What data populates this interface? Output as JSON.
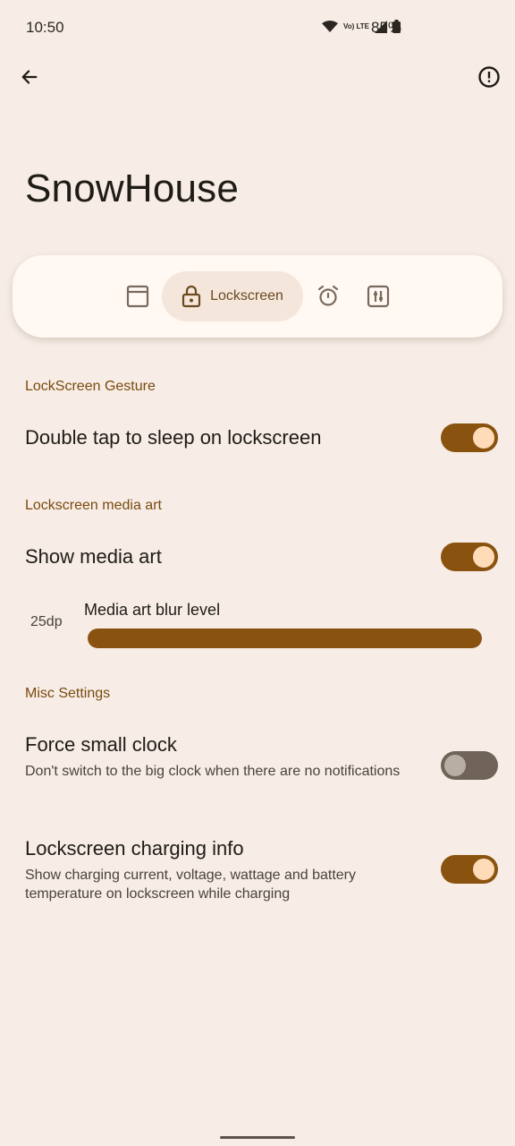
{
  "status_bar": {
    "time": "10:50",
    "signal_label": "Vo) LTE",
    "battery_percent": "85%"
  },
  "app_bar": {
    "back_icon": "arrow-left-icon",
    "info_icon": "info-circle-icon"
  },
  "page": {
    "title": "SnowHouse"
  },
  "tabs": {
    "items": [
      {
        "icon": "window-icon",
        "label": ""
      },
      {
        "icon": "lock-icon",
        "label": "Lockscreen",
        "selected": true
      },
      {
        "icon": "alarm-icon",
        "label": ""
      },
      {
        "icon": "sliders-icon",
        "label": ""
      }
    ]
  },
  "sections": {
    "gesture": {
      "header": "LockScreen Gesture",
      "double_tap": {
        "title": "Double tap to sleep on lockscreen",
        "enabled": true
      }
    },
    "media_art": {
      "header": "Lockscreen media art",
      "show_media_art": {
        "title": "Show media art",
        "enabled": true
      },
      "blur": {
        "label": "Media art blur level",
        "value_text": "25dp",
        "fraction": 1.0
      }
    },
    "misc": {
      "header": "Misc Settings",
      "small_clock": {
        "title": "Force small clock",
        "subtitle": "Don't switch to the big clock when there are no notifications",
        "enabled": false
      },
      "charging_info": {
        "title": "Lockscreen charging info",
        "subtitle": "Show charging current, voltage, wattage and battery temperature on lockscreen while charging",
        "enabled": true
      }
    }
  },
  "colors": {
    "background": "#f7ede6",
    "accent": "#8a520f",
    "section_header": "#7a4a0f"
  }
}
